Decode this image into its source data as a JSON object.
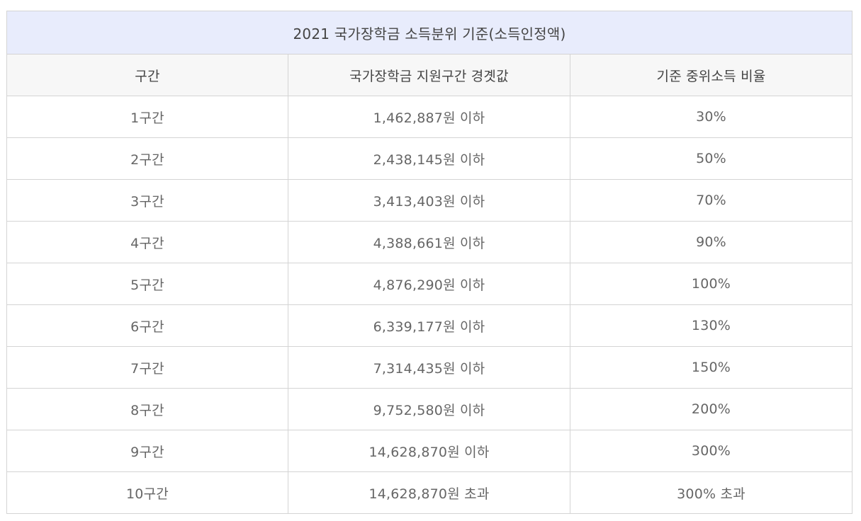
{
  "table": {
    "title": "2021 국가장학금 소득분위 기준(소득인정액)",
    "headers": [
      "구간",
      "국가장학금 지원구간 경곗값",
      "기준 중위소득 비율"
    ],
    "rows": [
      [
        "1구간",
        "1,462,887원 이하",
        "30%"
      ],
      [
        "2구간",
        "2,438,145원 이하",
        "50%"
      ],
      [
        "3구간",
        "3,413,403원 이하",
        "70%"
      ],
      [
        "4구간",
        "4,388,661원 이하",
        "90%"
      ],
      [
        "5구간",
        "4,876,290원 이하",
        "100%"
      ],
      [
        "6구간",
        "6,339,177원 이하",
        "130%"
      ],
      [
        "7구간",
        "7,314,435원 이하",
        "150%"
      ],
      [
        "8구간",
        "9,752,580원 이하",
        "200%"
      ],
      [
        "9구간",
        "14,628,870원 이하",
        "300%"
      ],
      [
        "10구간",
        "14,628,870원 초과",
        "300% 초과"
      ]
    ]
  },
  "colors": {
    "title_background": "#e8ecfc",
    "header_background": "#f7f7f7",
    "border": "#d4d4d4",
    "text": "#555555"
  }
}
